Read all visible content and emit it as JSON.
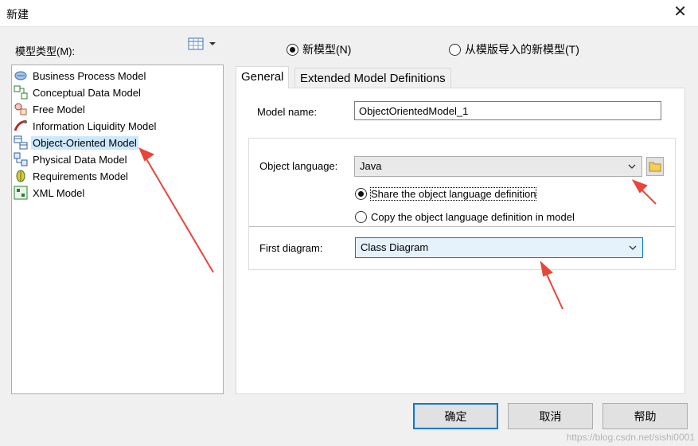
{
  "window": {
    "title": "新建",
    "close": "✕"
  },
  "left": {
    "types_label": "模型类型(M):",
    "items": [
      {
        "label": "Business Process Model",
        "icon": "business-process-icon",
        "selected": false
      },
      {
        "label": "Conceptual Data Model",
        "icon": "conceptual-data-icon",
        "selected": false
      },
      {
        "label": "Free Model",
        "icon": "free-model-icon",
        "selected": false
      },
      {
        "label": "Information Liquidity Model",
        "icon": "information-liquidity-icon",
        "selected": false
      },
      {
        "label": "Object-Oriented Model",
        "icon": "object-oriented-icon",
        "selected": true
      },
      {
        "label": "Physical Data Model",
        "icon": "physical-data-icon",
        "selected": false
      },
      {
        "label": "Requirements Model",
        "icon": "requirements-icon",
        "selected": false
      },
      {
        "label": "XML Model",
        "icon": "xml-model-icon",
        "selected": false
      }
    ]
  },
  "mode": {
    "new_model": "新模型(N)",
    "from_template": "从模版导入的新模型(T)",
    "selected": "new_model"
  },
  "tabs": [
    {
      "label": "General",
      "active": true
    },
    {
      "label": "Extended Model Definitions",
      "active": false
    }
  ],
  "general": {
    "model_name_label": "Model name:",
    "model_name_value": "ObjectOrientedModel_1",
    "object_language_label": "Object language:",
    "object_language_value": "Java",
    "share_option": "Share the object language definition",
    "copy_option": "Copy the object language definition in model",
    "first_diagram_label": "First diagram:",
    "first_diagram_value": "Class Diagram"
  },
  "buttons": {
    "ok": "确定",
    "cancel": "取消",
    "help": "帮助"
  },
  "watermark": "https://blog.csdn.net/sishi0001",
  "colors": {
    "accent": "#0078d7",
    "selection": "#cce8ff",
    "arrow": "#e8463a"
  }
}
